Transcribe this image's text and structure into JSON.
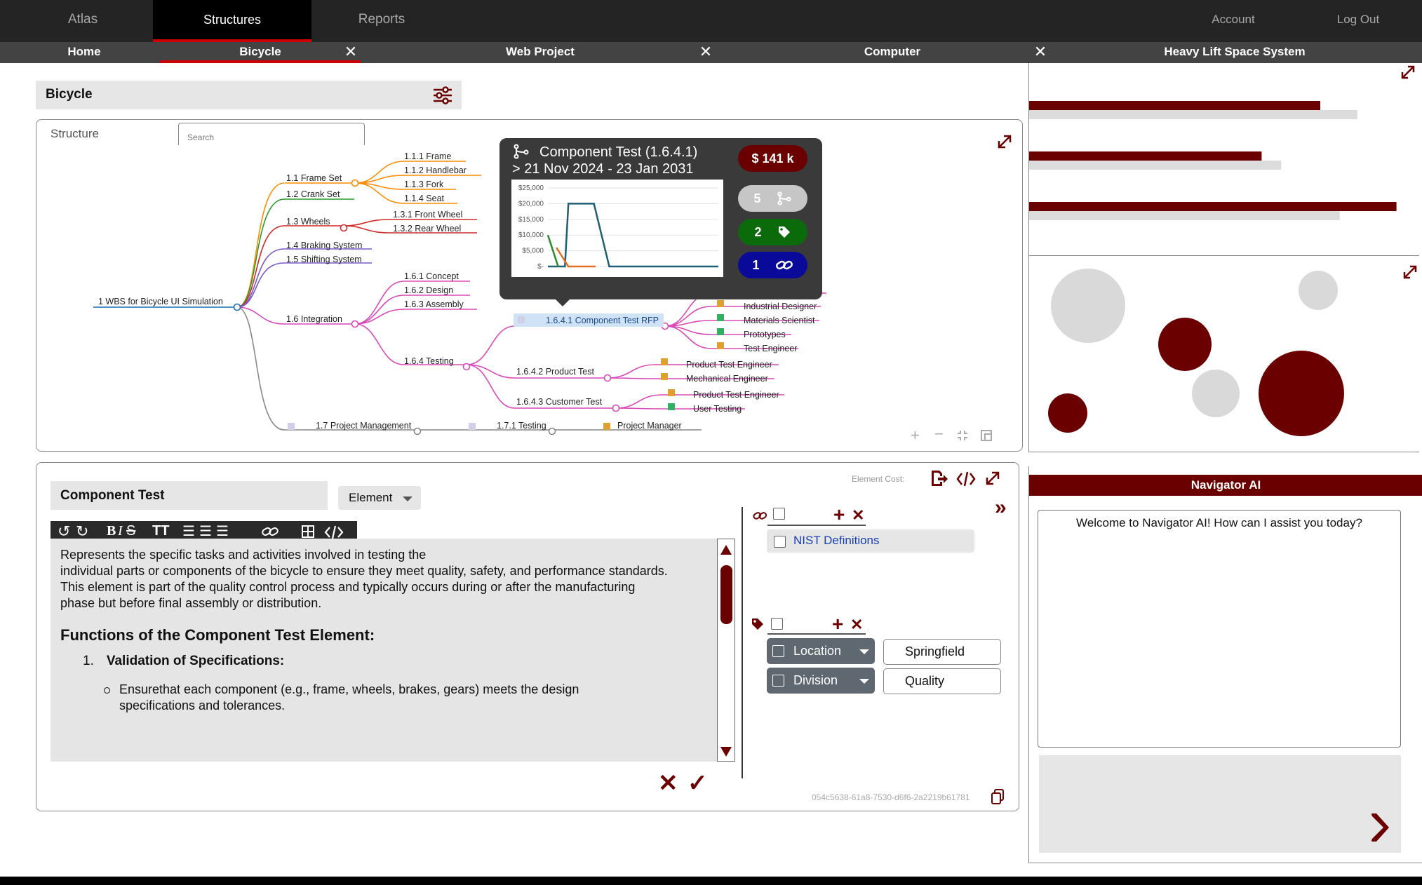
{
  "topnav": {
    "items": [
      "Atlas",
      "Structures",
      "Reports"
    ],
    "right_items": [
      "Account",
      "Log Out"
    ]
  },
  "tabs": [
    "Home",
    "Bicycle",
    "Web Project",
    "Computer",
    "Heavy Lift Space System"
  ],
  "page": {
    "title": "Bicycle"
  },
  "structure": {
    "label": "Structure",
    "search_placeholder": "Search",
    "nodes": {
      "root": "1 WBS for Bicycle UI Simulation",
      "frame_set": "1.1 Frame Set",
      "frame": "1.1.1 Frame",
      "handlebar": "1.1.2 Handlebar",
      "fork": "1.1.3 Fork",
      "seat": "1.1.4 Seat",
      "crank_set": "1.2 Crank Set",
      "wheels": "1.3 Wheels",
      "front_wheel": "1.3.1 Front Wheel",
      "rear_wheel": "1.3.2 Rear Wheel",
      "braking": "1.4 Braking System",
      "shifting": "1.5 Shifting System",
      "integration": "1.6 Integration",
      "concept": "1.6.1 Concept",
      "design": "1.6.2 Design",
      "assembly": "1.6.3 Assembly",
      "testing": "1.6.4 Testing",
      "component_rfp": "1.6.4.1 Component Test RFP",
      "product_test": "1.6.4.2 Product Test",
      "customer_test": "1.6.4.3 Customer Test",
      "project_mgmt": "1.7 Project Management",
      "pm_testing": "1.7.1 Testing",
      "project_manager": "Project Manager",
      "industrial_designer": "Industrial Designer",
      "materials_scientist": "Materials Scientist",
      "prototypes": "Prototypes",
      "test_engineer": "Test Engineer",
      "product_test_engineer_a": "Product Test Engineer",
      "mechanical_engineer": "Mechanical Engineer",
      "product_test_engineer_b": "Product Test Engineer",
      "user_testing": "User Testing",
      "partial_er": "er"
    }
  },
  "popup": {
    "title": "Component Test (1.6.4.1)",
    "dates": "> 21 Nov 2024 - 23 Jan 2031",
    "cost": "$ 141 k",
    "children_count": "5",
    "tags_count": "2",
    "links_count": "1",
    "chart_data": {
      "type": "line",
      "ylim": [
        0,
        25000
      ],
      "yticks": [
        "$25,000",
        "$20,000",
        "$15,000",
        "$10,000",
        "$5,000",
        "$-"
      ],
      "series": [
        {
          "color": "#1f5f73",
          "points": [
            [
              0,
              0
            ],
            [
              0.1,
              0
            ],
            [
              0.12,
              20000
            ],
            [
              0.27,
              20000
            ],
            [
              0.36,
              0
            ],
            [
              1.0,
              0
            ]
          ]
        },
        {
          "color": "#e07020",
          "points": [
            [
              0.05,
              6000
            ],
            [
              0.12,
              0
            ],
            [
              0.28,
              0
            ]
          ]
        },
        {
          "color": "#2a8a2a",
          "points": [
            [
              0.0,
              10000
            ],
            [
              0.06,
              0
            ]
          ]
        }
      ]
    }
  },
  "right_charts": {
    "bars": [
      {
        "dark": 0.745,
        "light": 0.84
      },
      {
        "dark": 0.595,
        "light": 0.645
      },
      {
        "dark": 0.94,
        "light": 0.795
      }
    ],
    "bubbles": [
      {
        "color": "#d9d9d9"
      },
      {
        "color": "#d9d9d9"
      },
      {
        "color": "#6a0000"
      },
      {
        "color": "#d9d9d9"
      },
      {
        "color": "#6a0000"
      },
      {
        "color": "#6a0000"
      }
    ]
  },
  "element": {
    "name": "Component Test",
    "type": "Element",
    "cost_label": "Element Cost:",
    "description_p": "Represents the specific tasks and activities involved in testing the individual parts or components of the bicycle to ensure they meet quality, safety, and performance standards. This element is part of the quality control process and typically occurs during or after the manufacturing phase but before final assembly or distribution.",
    "description_p1": "Represents the specific tasks and activities involved in testing the",
    "description_p2": "individual parts or components of the bicycle to ensure they meet quality, safety, and performance standards.",
    "description_p3": "This element is part of the quality control process and typically occurs during or after the manufacturing",
    "description_p4": "phase but before final assembly or distribution.",
    "heading": "Functions of the Component Test Element:",
    "list_num": "1.",
    "list_item": "Validation of Specifications:",
    "sub_item1": "Ensurethat each component (e.g., frame, wheels, brakes, gears) meets the design",
    "sub_item2": "specifications and tolerances.",
    "uuid": "054c5638-61a8-7530-d6f6-2a2219b61781",
    "links": [
      "NIST Definitions"
    ],
    "tags": [
      {
        "key": "Location",
        "value": "Springfield"
      },
      {
        "key": "Division",
        "value": "Quality"
      }
    ]
  },
  "navigator": {
    "title": "Navigator AI",
    "welcome": "Welcome to Navigator AI!  How can I assist you today?"
  },
  "colors": {
    "accent": "#6a0000",
    "active_red": "#cc0000",
    "green": "#0b6b0b",
    "blue": "#0a0a9a"
  }
}
